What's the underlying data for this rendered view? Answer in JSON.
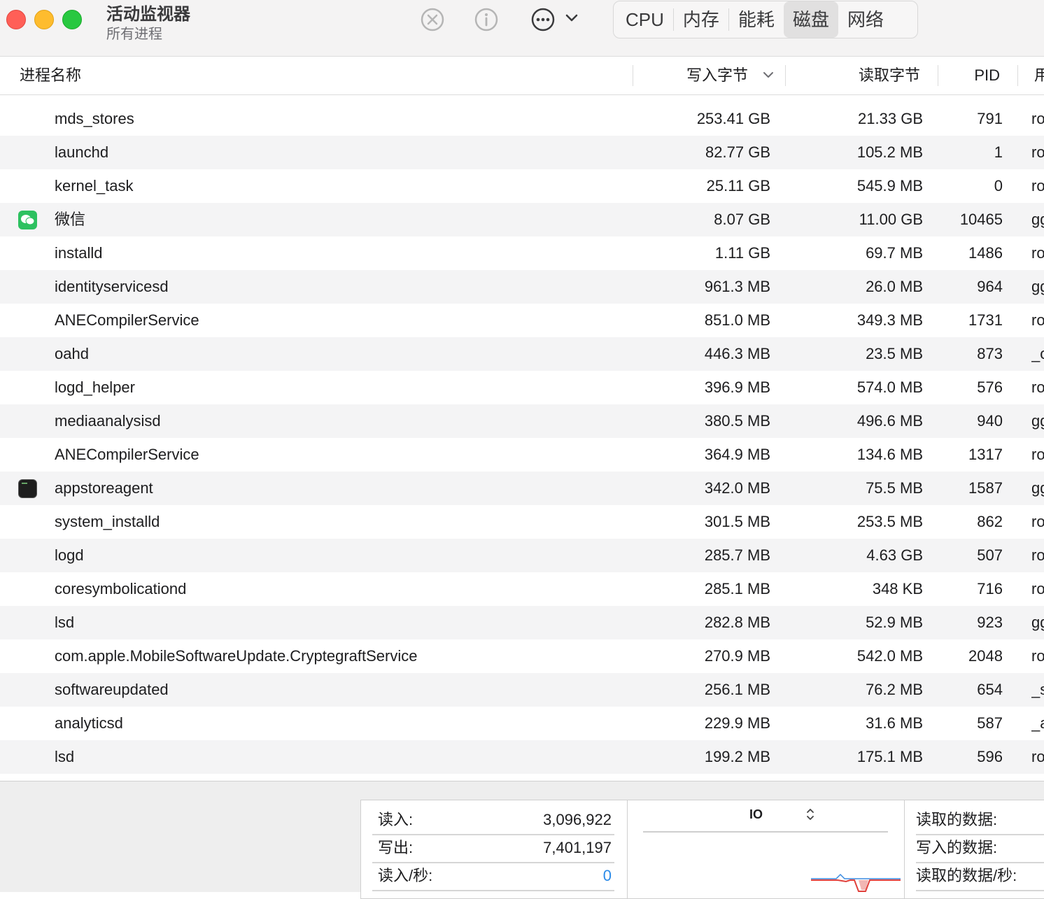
{
  "window": {
    "title": "活动监视器",
    "subtitle": "所有进程"
  },
  "toolbar": {
    "icons": [
      "stop-process-icon",
      "info-icon",
      "more-options-icon",
      "chevron-down-icon"
    ]
  },
  "tabs": [
    {
      "label": "CPU",
      "active": false
    },
    {
      "label": "内存",
      "active": false
    },
    {
      "label": "能耗",
      "active": false
    },
    {
      "label": "磁盘",
      "active": true
    },
    {
      "label": "网络",
      "active": false
    }
  ],
  "table": {
    "headers": {
      "name": "进程名称",
      "write": "写入字节",
      "read": "读取字节",
      "pid": "PID",
      "user": "用"
    },
    "rows": [
      {
        "name": "mds_stores",
        "write": "253.41 GB",
        "read": "21.33 GB",
        "pid": "791",
        "user": "ro",
        "icon": ""
      },
      {
        "name": "launchd",
        "write": "82.77 GB",
        "read": "105.2 MB",
        "pid": "1",
        "user": "ro",
        "icon": ""
      },
      {
        "name": "kernel_task",
        "write": "25.11 GB",
        "read": "545.9 MB",
        "pid": "0",
        "user": "ro",
        "icon": ""
      },
      {
        "name": "微信",
        "write": "8.07 GB",
        "read": "11.00 GB",
        "pid": "10465",
        "user": "gg",
        "icon": "wechat-icon"
      },
      {
        "name": "installd",
        "write": "1.11 GB",
        "read": "69.7 MB",
        "pid": "1486",
        "user": "ro",
        "icon": ""
      },
      {
        "name": "identityservicesd",
        "write": "961.3 MB",
        "read": "26.0 MB",
        "pid": "964",
        "user": "gg",
        "icon": ""
      },
      {
        "name": "ANECompilerService",
        "write": "851.0 MB",
        "read": "349.3 MB",
        "pid": "1731",
        "user": "ro",
        "icon": ""
      },
      {
        "name": "oahd",
        "write": "446.3 MB",
        "read": "23.5 MB",
        "pid": "873",
        "user": "_o",
        "icon": ""
      },
      {
        "name": "logd_helper",
        "write": "396.9 MB",
        "read": "574.0 MB",
        "pid": "576",
        "user": "ro",
        "icon": ""
      },
      {
        "name": "mediaanalysisd",
        "write": "380.5 MB",
        "read": "496.6 MB",
        "pid": "940",
        "user": "gg",
        "icon": ""
      },
      {
        "name": "ANECompilerService",
        "write": "364.9 MB",
        "read": "134.6 MB",
        "pid": "1317",
        "user": "ro",
        "icon": ""
      },
      {
        "name": "appstoreagent",
        "write": "342.0 MB",
        "read": "75.5 MB",
        "pid": "1587",
        "user": "gg",
        "icon": "terminal-icon"
      },
      {
        "name": "system_installd",
        "write": "301.5 MB",
        "read": "253.5 MB",
        "pid": "862",
        "user": "ro",
        "icon": ""
      },
      {
        "name": "logd",
        "write": "285.7 MB",
        "read": "4.63 GB",
        "pid": "507",
        "user": "ro",
        "icon": ""
      },
      {
        "name": "coresymbolicationd",
        "write": "285.1 MB",
        "read": "348 KB",
        "pid": "716",
        "user": "ro",
        "icon": ""
      },
      {
        "name": "lsd",
        "write": "282.8 MB",
        "read": "52.9 MB",
        "pid": "923",
        "user": "gg",
        "icon": ""
      },
      {
        "name": "com.apple.MobileSoftwareUpdate.CryptegraftService",
        "write": "270.9 MB",
        "read": "542.0 MB",
        "pid": "2048",
        "user": "ro",
        "icon": ""
      },
      {
        "name": "softwareupdated",
        "write": "256.1 MB",
        "read": "76.2 MB",
        "pid": "654",
        "user": "_s",
        "icon": ""
      },
      {
        "name": "analyticsd",
        "write": "229.9 MB",
        "read": "31.6 MB",
        "pid": "587",
        "user": "_a",
        "icon": ""
      },
      {
        "name": "lsd",
        "write": "199.2 MB",
        "read": "175.1 MB",
        "pid": "596",
        "user": "ro",
        "icon": ""
      }
    ]
  },
  "footer": {
    "left": [
      {
        "label": "读入:",
        "value": "3,096,922"
      },
      {
        "label": "写出:",
        "value": "7,401,197"
      },
      {
        "label": "读入/秒:",
        "value": "0"
      }
    ],
    "chart_title": "IO",
    "right": [
      "读取的数据:",
      "写入的数据:",
      "读取的数据/秒:"
    ]
  },
  "colors": {
    "read_line": "#3b8be0",
    "write_line": "#e0403b",
    "active_tab_bg": "#e1e0e0"
  }
}
